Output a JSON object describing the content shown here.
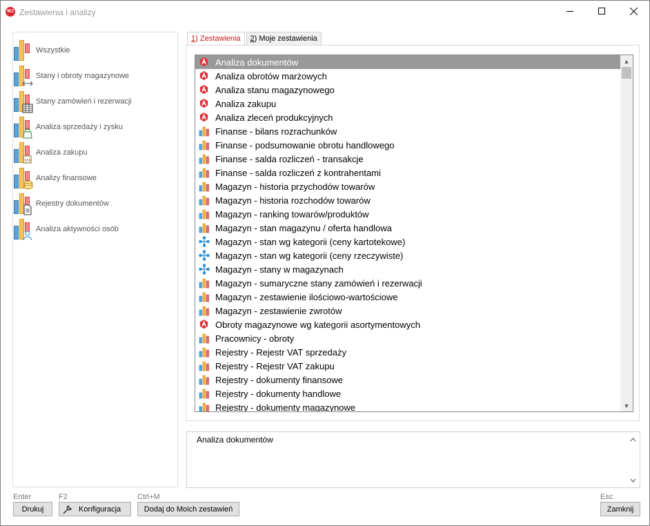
{
  "window": {
    "title": "Zestawienia i analizy",
    "app_icon_text": "MJ"
  },
  "categories": [
    {
      "label": "Wszystkie",
      "overlay": "none"
    },
    {
      "label": "Stany i obroty magazynowe",
      "overlay": "arrows"
    },
    {
      "label": "Stany zamówień i rezerwacji",
      "overlay": "grid"
    },
    {
      "label": "Analiza sprzedaży i zysku",
      "overlay": "bag"
    },
    {
      "label": "Analiza zakupu",
      "overlay": "cart"
    },
    {
      "label": "Analizy finansowe",
      "overlay": "coins"
    },
    {
      "label": "Rejestry dokumentów",
      "overlay": "document"
    },
    {
      "label": "Analiza aktywności osób",
      "overlay": "person"
    }
  ],
  "tabs": [
    {
      "key": "1",
      "label": ") Zestawienia",
      "active": true
    },
    {
      "key": "2",
      "label": ") Moje zestawienia",
      "active": false
    }
  ],
  "reports": [
    {
      "label": "Analiza dokumentów",
      "icon": "red-a",
      "selected": true
    },
    {
      "label": "Analiza obrotów marżowych",
      "icon": "red-a"
    },
    {
      "label": "Analiza stanu magazynowego",
      "icon": "red-a"
    },
    {
      "label": "Analiza zakupu",
      "icon": "red-a"
    },
    {
      "label": "Analiza zleceń produkcyjnych",
      "icon": "red-a"
    },
    {
      "label": "Finanse - bilans rozrachunków",
      "icon": "bars"
    },
    {
      "label": "Finanse - podsumowanie obrotu handlowego",
      "icon": "bars"
    },
    {
      "label": "Finanse - salda rozliczeń - transakcje",
      "icon": "bars"
    },
    {
      "label": "Finanse - salda rozliczeń z kontrahentami",
      "icon": "bars"
    },
    {
      "label": "Magazyn - historia przychodów towarów",
      "icon": "bars"
    },
    {
      "label": "Magazyn - historia rozchodów towarów",
      "icon": "bars"
    },
    {
      "label": "Magazyn - ranking towarów/produktów",
      "icon": "bars"
    },
    {
      "label": "Magazyn - stan magazynu / oferta handlowa",
      "icon": "bars"
    },
    {
      "label": "Magazyn - stan wg kategorii (ceny kartotekowe)",
      "icon": "tree"
    },
    {
      "label": "Magazyn - stan wg kategorii (ceny rzeczywiste)",
      "icon": "tree"
    },
    {
      "label": "Magazyn - stany w magazynach",
      "icon": "tree"
    },
    {
      "label": "Magazyn - sumaryczne stany zamówień i rezerwacji",
      "icon": "bars"
    },
    {
      "label": "Magazyn - zestawienie ilościowo-wartościowe",
      "icon": "bars"
    },
    {
      "label": "Magazyn - zestawienie zwrotów",
      "icon": "bars"
    },
    {
      "label": "Obroty magazynowe wg kategorii asortymentowych",
      "icon": "red-a"
    },
    {
      "label": "Pracownicy - obroty",
      "icon": "bars"
    },
    {
      "label": "Rejestry - Rejestr VAT sprzedaży",
      "icon": "bars"
    },
    {
      "label": "Rejestry - Rejestr VAT zakupu",
      "icon": "bars"
    },
    {
      "label": "Rejestry - dokumenty finansowe",
      "icon": "bars"
    },
    {
      "label": "Rejestry - dokumenty handlowe",
      "icon": "bars"
    },
    {
      "label": "Rejestry - dokumenty magazynowe",
      "icon": "bars"
    }
  ],
  "description": "Analiza dokumentów",
  "buttons": {
    "print": {
      "shortcut": "Enter",
      "label": "Drukuj"
    },
    "config": {
      "shortcut": "F2",
      "label": "Konfiguracja"
    },
    "add": {
      "shortcut": "Ctrl+M",
      "label": "Dodaj do Moich zestawień"
    },
    "close": {
      "shortcut": "Esc",
      "label": "Zamknij"
    }
  },
  "colors": {
    "selected_row": "#999999",
    "active_tab_text": "#c21a1a",
    "red_a": "#e0303a",
    "bar_blue": "#5aa5dc",
    "bar_orange": "#f5b547",
    "bar_red": "#e96a6a",
    "tree_blue": "#2f8fd8"
  }
}
